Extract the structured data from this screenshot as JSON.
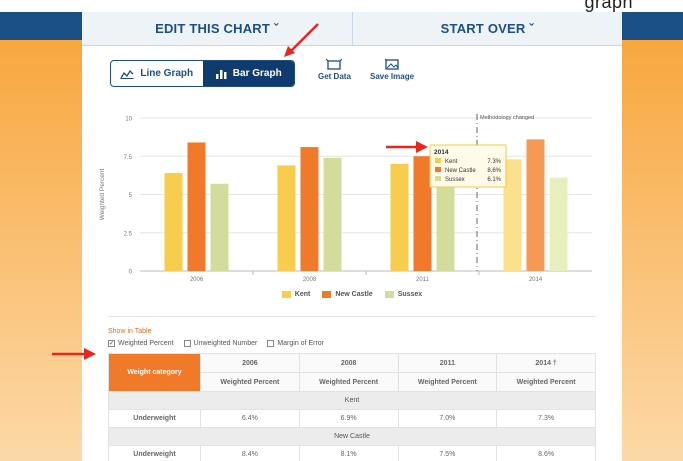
{
  "top_bar": {
    "edit_label": "EDIT THIS CHART ˇ",
    "start_over_label": "START OVER ˇ"
  },
  "header_fragment": "graph",
  "toggle": {
    "line_label": "Line Graph",
    "bar_label": "Bar Graph",
    "active": "bar"
  },
  "tools": {
    "get_data_label": "Get Data",
    "save_image_label": "Save Image"
  },
  "chart_data": {
    "type": "bar",
    "categories": [
      "2006",
      "2008",
      "2011",
      "2014"
    ],
    "series": [
      {
        "name": "Kent",
        "color": "#f8cc4c",
        "values": [
          6.4,
          6.9,
          7.0,
          7.3
        ]
      },
      {
        "name": "New Castle",
        "color": "#f0792a",
        "values": [
          8.4,
          8.1,
          7.5,
          8.6
        ]
      },
      {
        "name": "Sussex",
        "color": "#d3dc9b",
        "values": [
          5.7,
          7.4,
          6.3,
          6.1
        ]
      }
    ],
    "ylabel": "Weighted Percent",
    "ylim": [
      0,
      10
    ],
    "yticks": [
      "0",
      "2.5",
      "5",
      "7.5",
      "10"
    ],
    "grid": true,
    "annotation": "Methodology changed",
    "tooltip": {
      "title": "2014",
      "rows": [
        {
          "name": "Kent",
          "value": "7.3%",
          "color": "#f8cc4c"
        },
        {
          "name": "New Castle",
          "value": "8.6%",
          "color": "#f0792a"
        },
        {
          "name": "Sussex",
          "value": "6.1%",
          "color": "#d3dc9b"
        }
      ]
    },
    "legend": [
      "Kent",
      "New Castle",
      "Sussex"
    ]
  },
  "table_options": {
    "title": "Show in Table",
    "options": [
      {
        "label": "Weighted Percent",
        "checked": true
      },
      {
        "label": "Unweighted Number",
        "checked": false
      },
      {
        "label": "Margin of Error",
        "checked": false
      }
    ]
  },
  "table": {
    "category_header": "Weight category",
    "years": [
      "2006",
      "2008",
      "2011",
      "2014 †"
    ],
    "subheader": "Weighted Percent",
    "groups": [
      {
        "name": "Kent",
        "rows": [
          {
            "label": "Underweight",
            "values": [
              "6.4%",
              "6.9%",
              "7.0%",
              "7.3%"
            ]
          }
        ]
      },
      {
        "name": "New Castle",
        "rows": [
          {
            "label": "Underweight",
            "values": [
              "8.4%",
              "8.1%",
              "7.5%",
              "8.6%"
            ]
          }
        ]
      }
    ]
  },
  "colors": {
    "navy": "#1c4f8a",
    "orange": "#f0792a",
    "annotation_red": "#e8251f"
  }
}
